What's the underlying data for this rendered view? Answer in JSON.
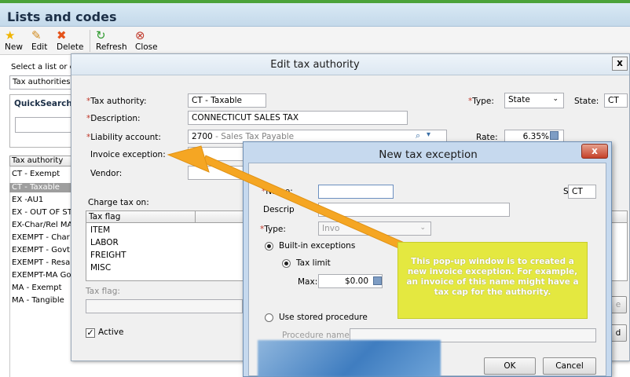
{
  "app": {
    "title": "Lists and codes"
  },
  "toolbar": {
    "new": "New",
    "edit": "Edit",
    "delete": "Delete",
    "refresh": "Refresh",
    "close": "Close"
  },
  "left": {
    "select_label": "Select a list or c",
    "list_select_value": "Tax authorities",
    "quicksearch_label": "QuickSearch",
    "column_header": "Tax authority",
    "rows": [
      "CT - Exempt",
      "CT - Taxable",
      "EX -AU1",
      "EX - OUT OF ST",
      "EX-Char/Rel MA",
      "EXEMPT - Char",
      "EXEMPT - Govt",
      "EXEMPT - Resa",
      "EXEMPT-MA Go",
      "MA - Exempt",
      "MA - Tangible"
    ]
  },
  "edit_dialog": {
    "title": "Edit tax authority",
    "close": "x",
    "tax_authority_label": "Tax authority:",
    "tax_authority_value": "CT - Taxable",
    "description_label": "Description:",
    "description_value": "CONNECTICUT SALES TAX",
    "liability_label": "Liability account:",
    "liability_value": "2700",
    "liability_desc": "- Sales Tax Payable",
    "invoice_exception_label": "Invoice exception:",
    "vendor_label": "Vendor:",
    "type_label": "Type:",
    "type_value": "State",
    "state_label": "State:",
    "state_value": "CT",
    "rate_label": "Rate:",
    "rate_value": "6.35%",
    "charge_tax_on_label": "Charge tax on:",
    "tax_flag_header": "Tax flag",
    "tax_flags": [
      "ITEM",
      "LABOR",
      "FREIGHT",
      "MISC"
    ],
    "tax_flag_field_label": "Tax flag:",
    "active_label": "Active",
    "partial_button_1": "e",
    "partial_button_2": "d"
  },
  "new_dialog": {
    "title": "New tax exception",
    "close": "x",
    "name_label": "Name:",
    "description_label": "Descrip",
    "type_label": "Type:",
    "type_value": "Invo",
    "state_label": "State:",
    "state_value": "CT",
    "builtin_label": "Built-in exceptions",
    "tax_limit_label": "Tax limit",
    "max_label": "Max:",
    "max_value": "$0.00",
    "stored_proc_label": "Use stored procedure",
    "procedure_name_label": "Procedure name:",
    "ok": "OK",
    "cancel": "Cancel"
  },
  "callout": {
    "text": "This pop-up window is to created a new invoice exception.  For example, an invoice of this name might have a tax cap for the authority."
  },
  "colors": {
    "accent_green": "#4aa23a",
    "callout_yellow": "#e4e840",
    "arrow_orange": "#f5a623",
    "required_red": "#c0392b"
  }
}
